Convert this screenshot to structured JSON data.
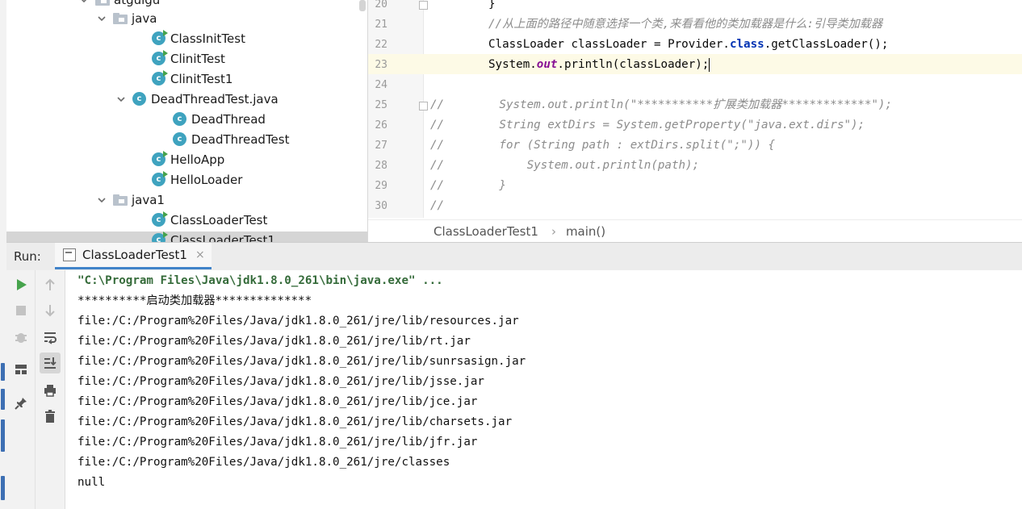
{
  "project_tree": {
    "items": [
      {
        "label": "atguigu",
        "kind": "package",
        "expanded": true
      },
      {
        "label": "java",
        "kind": "package",
        "expanded": true
      },
      {
        "label": "ClassInitTest",
        "kind": "class"
      },
      {
        "label": "ClinitTest",
        "kind": "class"
      },
      {
        "label": "ClinitTest1",
        "kind": "class"
      },
      {
        "label": "DeadThreadTest.java",
        "kind": "file",
        "expanded": true
      },
      {
        "label": "DeadThread",
        "kind": "class"
      },
      {
        "label": "DeadThreadTest",
        "kind": "class"
      },
      {
        "label": "HelloApp",
        "kind": "class"
      },
      {
        "label": "HelloLoader",
        "kind": "class"
      },
      {
        "label": "java1",
        "kind": "package",
        "expanded": true
      },
      {
        "label": "ClassLoaderTest",
        "kind": "class"
      },
      {
        "label": "ClassLoaderTest1",
        "kind": "class",
        "selected": true
      }
    ]
  },
  "editor": {
    "line_numbers": [
      "20",
      "21",
      "22",
      "23",
      "24",
      "25",
      "26",
      "27",
      "28",
      "29",
      "30"
    ],
    "current_line": "23",
    "lines": [
      [
        {
          "t": "}",
          "s": "plain"
        }
      ],
      [
        {
          "t": "//从上面的路径中随意选择一个类,来看看他的类加载器是什么:引导类加载器",
          "s": "cmt"
        }
      ],
      [
        {
          "t": "ClassLoader classLoader = Provider.",
          "s": "plain"
        },
        {
          "t": "class",
          "s": "kw"
        },
        {
          "t": ".getClassLoader();",
          "s": "plain"
        }
      ],
      [
        {
          "t": "System.",
          "s": "plain"
        },
        {
          "t": "out",
          "s": "field"
        },
        {
          "t": ".println(classLoader);",
          "s": "plain"
        }
      ],
      [],
      [
        {
          "t": "//        System.out.println(\"***********扩展类加载器*************\");",
          "s": "cmt"
        }
      ],
      [
        {
          "t": "//        String extDirs = System.getProperty(\"java.ext.dirs\");",
          "s": "cmt"
        }
      ],
      [
        {
          "t": "//        for (String path : extDirs.split(\";\")) {",
          "s": "cmt"
        }
      ],
      [
        {
          "t": "//            System.out.println(path);",
          "s": "cmt"
        }
      ],
      [
        {
          "t": "//        }",
          "s": "cmt"
        }
      ],
      [
        {
          "t": "//",
          "s": "cmt"
        }
      ]
    ]
  },
  "breadcrumb": {
    "items": [
      "ClassLoaderTest1",
      "main()"
    ],
    "separator": "›"
  },
  "run_panel": {
    "label": "Run:",
    "tab_label": "ClassLoaderTest1",
    "tab_close": "×",
    "left_toolbar": [
      "rerun-icon",
      "stop-icon",
      "debug-icon",
      "layout-icon",
      "pin-icon"
    ],
    "right_toolbar": [
      "up-arrow-icon",
      "down-arrow-icon",
      "soft-wrap-icon",
      "scroll-to-end-icon",
      "print-icon",
      "trash-icon"
    ],
    "console_lines": [
      "\"C:\\Program Files\\Java\\jdk1.8.0_261\\bin\\java.exe\" ...",
      "**********启动类加载器**************",
      "file:/C:/Program%20Files/Java/jdk1.8.0_261/jre/lib/resources.jar",
      "file:/C:/Program%20Files/Java/jdk1.8.0_261/jre/lib/rt.jar",
      "file:/C:/Program%20Files/Java/jdk1.8.0_261/jre/lib/sunrsasign.jar",
      "file:/C:/Program%20Files/Java/jdk1.8.0_261/jre/lib/jsse.jar",
      "file:/C:/Program%20Files/Java/jdk1.8.0_261/jre/lib/jce.jar",
      "file:/C:/Program%20Files/Java/jdk1.8.0_261/jre/lib/charsets.jar",
      "file:/C:/Program%20Files/Java/jdk1.8.0_261/jre/lib/jfr.jar",
      "file:/C:/Program%20Files/Java/jdk1.8.0_261/jre/classes",
      "null"
    ]
  },
  "colors": {
    "keyword": "#0033b3",
    "static_field": "#871094",
    "comment": "#8c8c8c",
    "class_icon": "#3fa3bf",
    "run_green": "#46a34c",
    "tab_underline": "#4083c9",
    "current_line": "#fdfae6"
  }
}
